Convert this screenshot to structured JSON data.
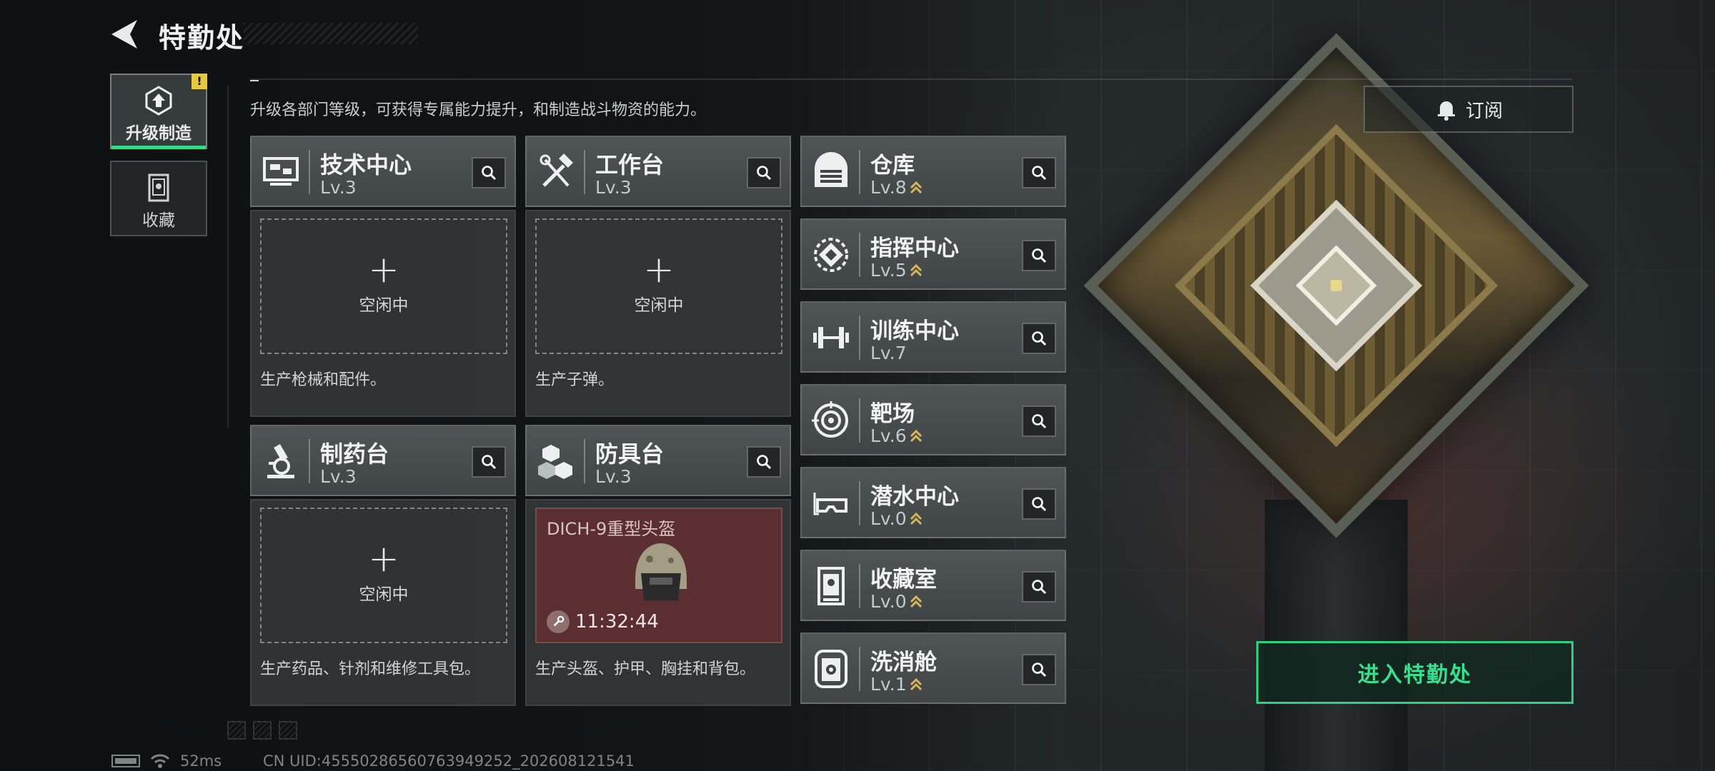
{
  "header": {
    "title": "特勤处"
  },
  "subtitle": "升级各部门等级，可获得专属能力提升，和制造战斗物资的能力。",
  "tabs": [
    {
      "label": "升级制造",
      "icon": "upgrade-icon",
      "active": true,
      "alert": "!"
    },
    {
      "label": "收藏",
      "icon": "collection-icon",
      "active": false
    }
  ],
  "subscribe": {
    "label": "订阅",
    "icon": "bell-icon"
  },
  "enter_button": "进入特勤处",
  "workshops": [
    {
      "name": "技术中心",
      "level": "Lv.3",
      "icon": "tech-center-icon",
      "slot_status": "空闲中",
      "description": "生产枪械和配件。"
    },
    {
      "name": "工作台",
      "level": "Lv.3",
      "icon": "hammer-wrench-icon",
      "slot_status": "空闲中",
      "description": "生产子弹。"
    },
    {
      "name": "制药台",
      "level": "Lv.3",
      "icon": "microscope-icon",
      "slot_status": "空闲中",
      "description": "生产药品、针剂和维修工具包。"
    },
    {
      "name": "防具台",
      "level": "Lv.3",
      "icon": "armor-blocks-icon",
      "description": "生产头盔、护甲、胸挂和背包。",
      "crafting": {
        "item": "DICH-9重型头盔",
        "timer": "11:32:44",
        "item_icon": "helmet-icon"
      }
    }
  ],
  "facilities": [
    {
      "name": "仓库",
      "level": "Lv.8",
      "icon": "warehouse-icon",
      "upgradable": true
    },
    {
      "name": "指挥中心",
      "level": "Lv.5",
      "icon": "command-chip-icon",
      "upgradable": true
    },
    {
      "name": "训练中心",
      "level": "Lv.7",
      "icon": "dumbbell-icon",
      "upgradable": false
    },
    {
      "name": "靶场",
      "level": "Lv.6",
      "icon": "target-icon",
      "upgradable": true
    },
    {
      "name": "潜水中心",
      "level": "Lv.0",
      "icon": "diving-mask-icon",
      "upgradable": true
    },
    {
      "name": "收藏室",
      "level": "Lv.0",
      "icon": "display-case-icon",
      "upgradable": true
    },
    {
      "name": "洗消舱",
      "level": "Lv.1",
      "icon": "decontamination-icon",
      "upgradable": true
    }
  ],
  "footer": {
    "ping": "52ms",
    "uid": "CN UID:4555028656076394925​2_202608121541"
  },
  "colors": {
    "accent_green": "#36d98b",
    "upgrade_chevron": "#d8b45a",
    "craft_bg": "#5b2f31"
  }
}
